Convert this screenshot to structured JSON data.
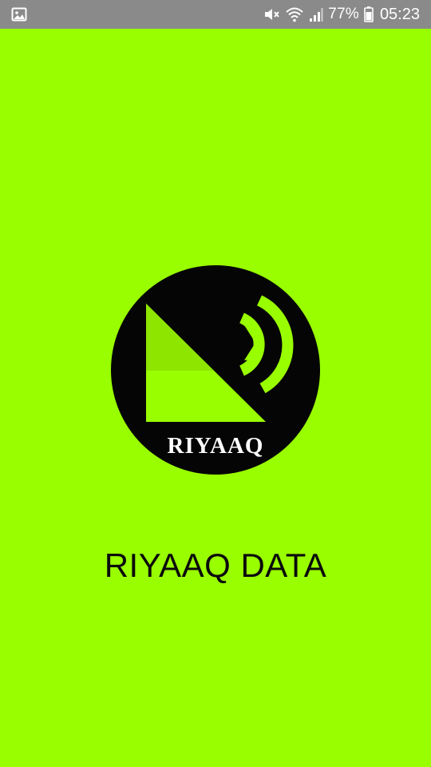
{
  "status_bar": {
    "battery_percent": "77%",
    "time": "05:23",
    "icons": [
      "image-icon",
      "mute-icon",
      "wifi-icon",
      "signal-icon",
      "battery-icon"
    ]
  },
  "splash": {
    "logo_text": "RIYAAQ",
    "app_name": "RIYAAQ DATA"
  },
  "colors": {
    "background": "#99ff00",
    "status_bar": "#8a8a8a",
    "logo_circle": "#050505",
    "logo_accent": "#99ff00"
  }
}
